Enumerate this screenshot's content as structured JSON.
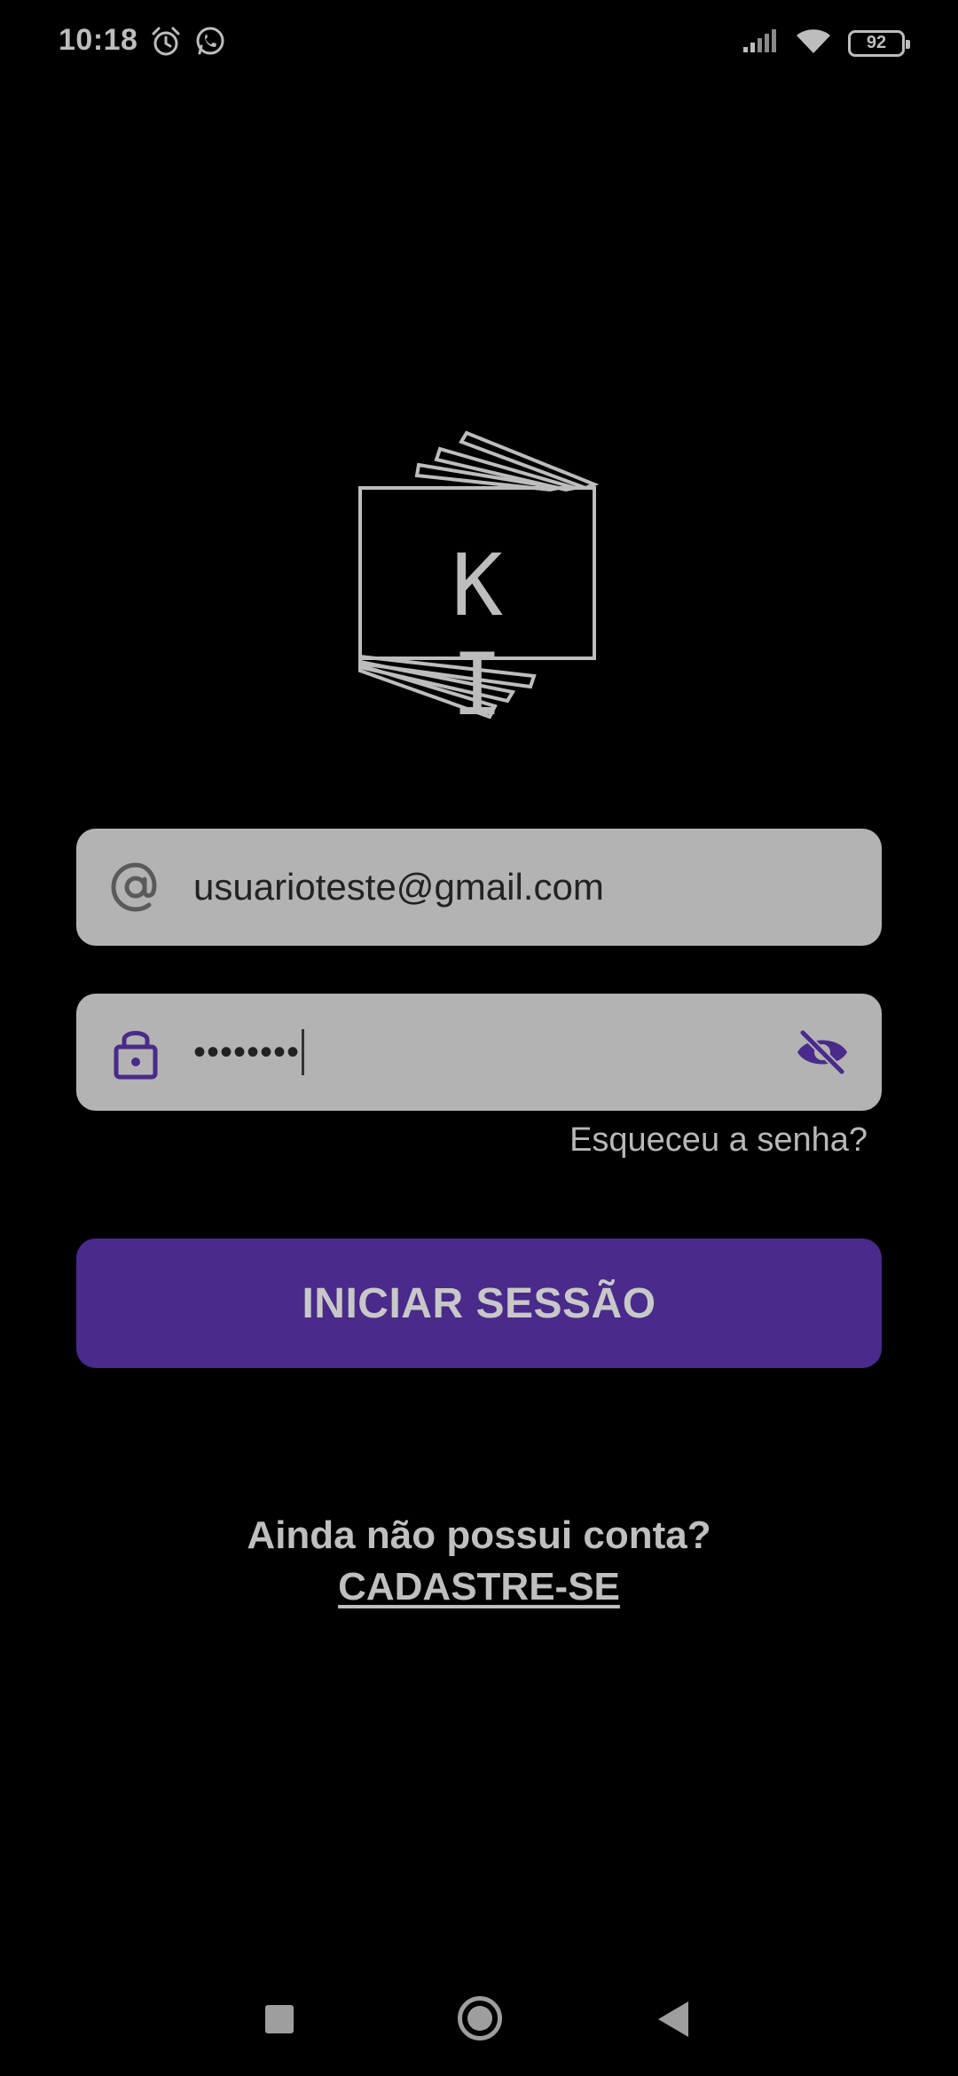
{
  "status_bar": {
    "time": "10:18",
    "left_icons": [
      "alarm-icon",
      "whatsapp-icon"
    ],
    "right_icons": [
      "signal-icon",
      "wifi-icon"
    ],
    "battery_level": "92"
  },
  "logo": {
    "text": "K I"
  },
  "login_form": {
    "email_value": "usuarioteste@gmail.com",
    "password_value": "••••••••",
    "forgot_password_label": "Esqueceu a senha?",
    "submit_label": "INICIAR SESSÃO"
  },
  "signup": {
    "prompt": "Ainda não possui conta?",
    "link_label": "CADASTRE-SE"
  },
  "colors": {
    "accent": "#4a2a8a",
    "field_background": "#b3b3b3",
    "page_background": "#000000"
  }
}
